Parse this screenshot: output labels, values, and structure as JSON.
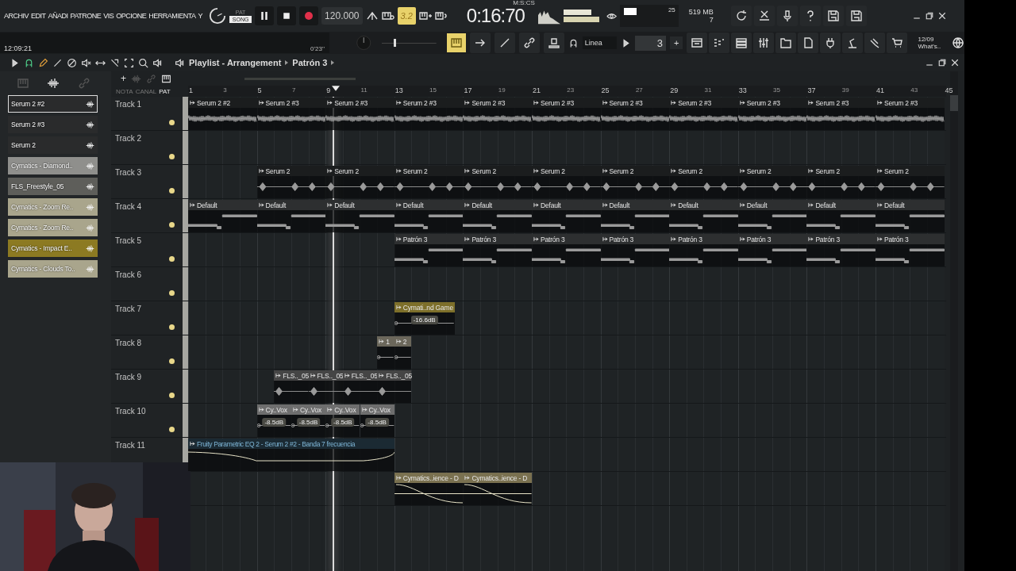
{
  "menu": [
    "ARCHIV",
    "EDIT",
    "AÑADI",
    "PATRONE",
    "VIS",
    "OPCIONE",
    "HERRAMIENTA",
    "Y"
  ],
  "transport": {
    "modes": [
      {
        "label": "PAT",
        "selected": false
      },
      {
        "label": "SONG",
        "selected": true
      }
    ],
    "tempo": "120.000",
    "step_label": "3.2",
    "time": "0:16:70",
    "time_format": "M:S:CS",
    "cpu": "25",
    "memory": "519 MB",
    "polyphony": "7"
  },
  "info": {
    "clock": "12:09:21",
    "duration": "0'23''"
  },
  "master_pitch": {
    "level": 0.2
  },
  "toolbar": {
    "snap": "Linea",
    "pattern": "3",
    "add": "+",
    "date": "12/09",
    "news": "What's.."
  },
  "playlist": {
    "title": "Playlist - Arrangement",
    "pattern": "Patrón 3",
    "add": "+",
    "view_modes": [
      {
        "label": "NOTA",
        "selected": false
      },
      {
        "label": "CANAL",
        "selected": false
      },
      {
        "label": "PAT",
        "selected": true
      }
    ]
  },
  "channels": [
    {
      "name": "Serum 2 #2",
      "color": "#2a2b2c",
      "selected": true
    },
    {
      "name": "Serum 2 #3",
      "color": "#2a2b2c",
      "selected": false
    },
    {
      "name": "Serum 2",
      "color": "#2a2b2c",
      "selected": false
    },
    {
      "name": "Cymatics - Diamond..",
      "color": "#8f8f8c",
      "selected": false
    },
    {
      "name": "FLS_Freestyle_05",
      "color": "#5e5e5a",
      "selected": false
    },
    {
      "name": "Cymatics - Zoom Re..",
      "color": "#a9a58c",
      "selected": false
    },
    {
      "name": "Cymatics - Zoom Re..",
      "color": "#a9a58c",
      "selected": false
    },
    {
      "name": "Cymatics - Impact E..",
      "color": "#8c7a22",
      "selected": false
    },
    {
      "name": "Cymatics - Clouds To..",
      "color": "#a9a58c",
      "selected": false
    }
  ],
  "ruler": [
    "1",
    "3",
    "5",
    "7",
    "9",
    "11",
    "13",
    "15",
    "17",
    "19",
    "21",
    "23",
    "25",
    "27",
    "29",
    "31",
    "33",
    "35",
    "37",
    "39",
    "41",
    "43",
    "45"
  ],
  "tracks": [
    {
      "name": "Track 1",
      "kind": "audio",
      "color": "#1b1d1e",
      "clips": [
        {
          "name": "Serum 2 #2"
        },
        {
          "name": "Serum 2 #3"
        },
        {
          "name": "Serum 2 #3"
        },
        {
          "name": "Serum 2 #3"
        },
        {
          "name": "Serum 2 #3"
        },
        {
          "name": "Serum 2 #3"
        },
        {
          "name": "Serum 2 #3"
        },
        {
          "name": "Serum 2 #3"
        },
        {
          "name": "Serum 2 #3"
        },
        {
          "name": "Serum 2 #3"
        },
        {
          "name": "Serum 2 #3"
        }
      ]
    },
    {
      "name": "Track 2"
    },
    {
      "name": "Track 3",
      "kind": "hits",
      "color": "#1b1d1e",
      "clips": [
        {
          "name": "Serum 2"
        },
        {
          "name": "Serum 2"
        },
        {
          "name": "Serum 2"
        },
        {
          "name": "Serum 2"
        },
        {
          "name": "Serum 2"
        },
        {
          "name": "Serum 2"
        },
        {
          "name": "Serum 2"
        },
        {
          "name": "Serum 2"
        },
        {
          "name": "Serum 2"
        },
        {
          "name": "Serum 2"
        }
      ]
    },
    {
      "name": "Track 4",
      "kind": "pattern",
      "color": "#2d2f30",
      "clips": [
        {
          "name": "Default"
        },
        {
          "name": "Default"
        },
        {
          "name": "Default"
        },
        {
          "name": "Default"
        },
        {
          "name": "Default"
        },
        {
          "name": "Default"
        },
        {
          "name": "Default"
        },
        {
          "name": "Default"
        },
        {
          "name": "Default"
        },
        {
          "name": "Default"
        },
        {
          "name": "Default"
        }
      ]
    },
    {
      "name": "Track 5",
      "kind": "pattern",
      "color": "#2d2f30",
      "clips": [
        {
          "name": "Patrón 3"
        },
        {
          "name": "Patrón 3"
        },
        {
          "name": "Patrón 3"
        },
        {
          "name": "Patrón 3"
        },
        {
          "name": "Patrón 3"
        },
        {
          "name": "Patrón 3"
        },
        {
          "name": "Patrón 3"
        },
        {
          "name": "Patrón 3"
        }
      ]
    },
    {
      "name": "Track 6"
    },
    {
      "name": "Track 7",
      "kind": "quiet",
      "color": "#7d6f2a",
      "clips": [
        {
          "name": "Cymati..nd Game",
          "gain": "-16.6dB"
        }
      ]
    },
    {
      "name": "Track 8",
      "kind": "quiet",
      "color": "#6b675b",
      "clips": [
        {
          "name": "1"
        },
        {
          "name": "2"
        }
      ]
    },
    {
      "name": "Track 9",
      "kind": "hits",
      "color": "#454545",
      "clips": [
        {
          "name": "FLS.._05"
        },
        {
          "name": "FLS.._05"
        },
        {
          "name": "FLS.._05"
        },
        {
          "name": "FLS.._05"
        }
      ]
    },
    {
      "name": "Track 10",
      "kind": "quiet",
      "color": "#6e6e6e",
      "clips": [
        {
          "name": "Cy..Vox",
          "gain": "-8.5dB"
        },
        {
          "name": "Cy..Vox",
          "gain": "-8.5dB"
        },
        {
          "name": "Cy..Vox",
          "gain": "-8.5dB"
        },
        {
          "name": "Cy..Vox",
          "gain": "-8.5dB"
        }
      ]
    },
    {
      "name": "Track 11",
      "kind": "automation",
      "color": "#1b2a33",
      "clips": [
        {
          "name": "Fruity Parametric EQ 2 - Serum 2 #2 - Banda 7 frecuencia"
        }
      ]
    },
    {
      "kind": "fade",
      "color": "#7a7150",
      "clips": [
        {
          "name": "Cymatics..ience - D"
        },
        {
          "name": "Cymatics..ience - D"
        }
      ]
    }
  ]
}
